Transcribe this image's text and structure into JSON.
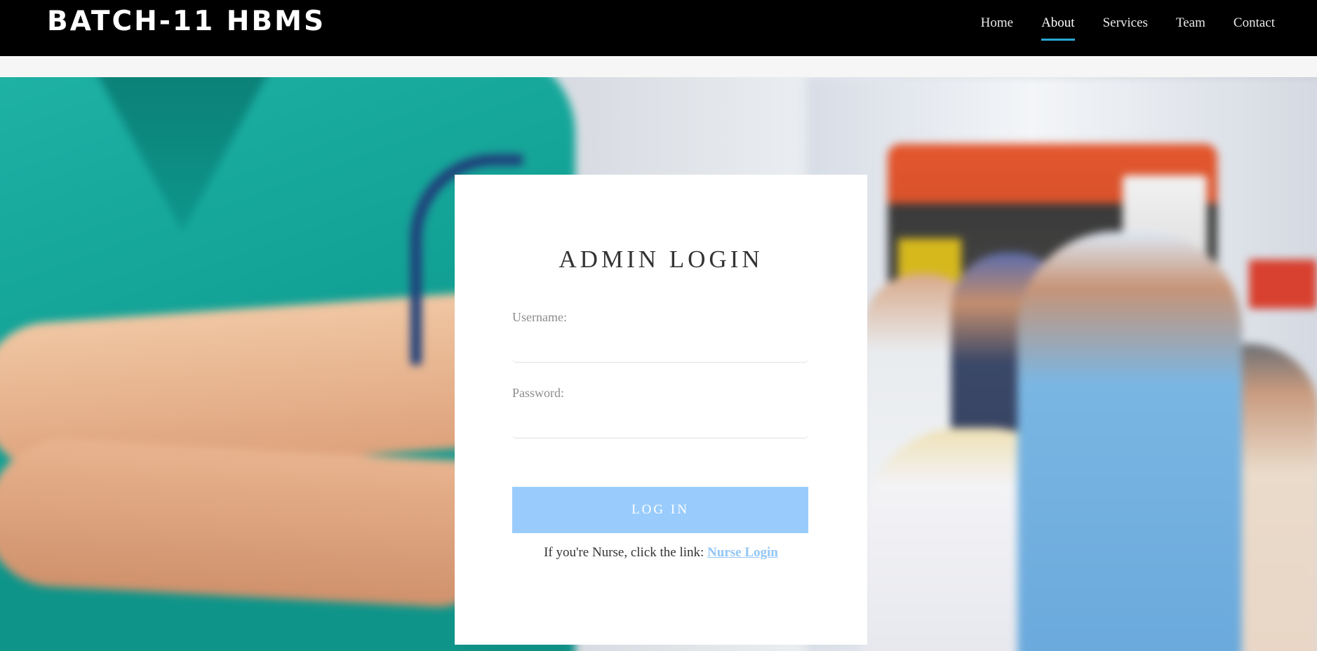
{
  "navbar": {
    "brand": "BATCH-11 HBMS",
    "items": [
      {
        "label": "Home",
        "active": false
      },
      {
        "label": "About",
        "active": true
      },
      {
        "label": "Services",
        "active": false
      },
      {
        "label": "Team",
        "active": false
      },
      {
        "label": "Contact",
        "active": false
      }
    ],
    "active_underline_color": "#2aa7d3"
  },
  "login": {
    "title": "ADMIN LOGIN",
    "username_label": "Username:",
    "username_value": "",
    "password_label": "Password:",
    "password_value": "",
    "button_label": "LOG IN",
    "button_color": "#99ccfc",
    "nurse_prompt": "If you're Nurse, click the link: ",
    "nurse_link_label": "Nurse Login"
  },
  "hero": {
    "image": "blurred photo of medical staff with crossed arms and ambulance scene"
  }
}
